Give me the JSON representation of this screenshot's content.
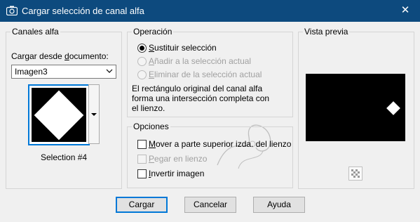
{
  "window": {
    "title": "Cargar selección de canal alfa",
    "close_glyph": "✕",
    "icon": "camera-icon"
  },
  "alpha_channels": {
    "group_label": "Canales alfa",
    "load_from_label_pre": "Cargar desde ",
    "load_from_label_u": "d",
    "load_from_label_post": "ocumento:",
    "document_value": "Imagen3",
    "selection_name": "Selection #4"
  },
  "operation": {
    "group_label": "Operación",
    "options": [
      {
        "pre": "",
        "u": "S",
        "post": "ustituir selección",
        "selected": true,
        "enabled": true
      },
      {
        "pre": "",
        "u": "A",
        "post": "ñadir a la selección actual",
        "selected": false,
        "enabled": false
      },
      {
        "pre": "",
        "u": "E",
        "post": "liminar de la selección actual",
        "selected": false,
        "enabled": false
      }
    ],
    "description_lines": [
      "El rectángulo original del canal alfa",
      "forma una intersección completa con",
      "el lienzo."
    ]
  },
  "options": {
    "group_label": "Opciones",
    "checkboxes": [
      {
        "pre": "",
        "u": "M",
        "post": "over a parte superior izda. del lienzo",
        "checked": false,
        "enabled": true
      },
      {
        "pre": "",
        "u": "P",
        "post": "egar en lienzo",
        "checked": false,
        "enabled": false
      },
      {
        "pre": "",
        "u": "I",
        "post": "nvertir imagen",
        "checked": false,
        "enabled": true
      }
    ]
  },
  "preview": {
    "group_label": "Vista previa",
    "zoom_icon": "checker-zoom-icon"
  },
  "buttons": {
    "load": "Cargar",
    "cancel": "Cancelar",
    "help": "Ayuda"
  }
}
